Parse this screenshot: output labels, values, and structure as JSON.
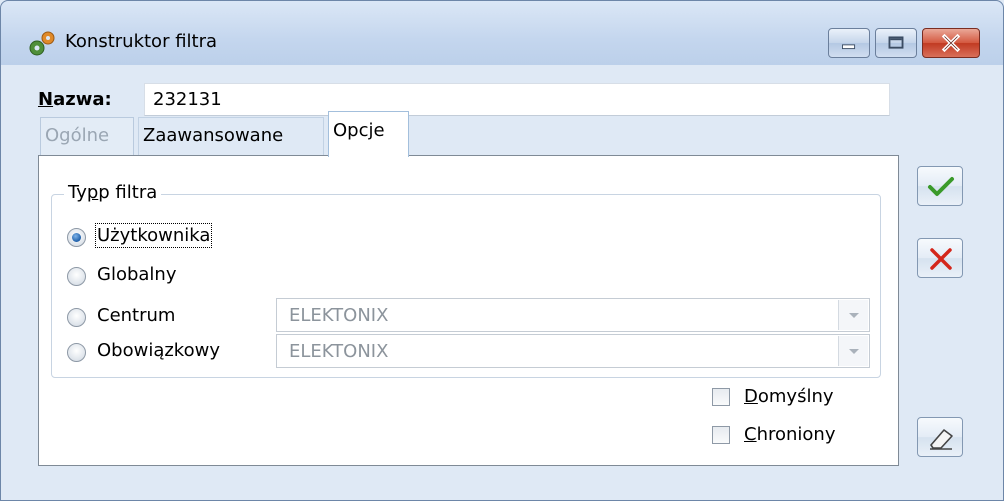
{
  "window": {
    "title": "Konstruktor filtra"
  },
  "form": {
    "name_label_first": "N",
    "name_label_rest": "azwa:",
    "name_value": "232131"
  },
  "tabs": [
    {
      "label": "Ogólne",
      "state": "disabled"
    },
    {
      "label": "Zaawansowane",
      "state": "normal"
    },
    {
      "label": "Opcje",
      "state": "active"
    }
  ],
  "filter_type": {
    "group_title_a": "Ty",
    "group_title_b": "p filtra",
    "options": [
      {
        "label": "Użytkownika",
        "checked": true
      },
      {
        "label": "Globalny",
        "checked": false
      },
      {
        "label": "Centrum",
        "checked": false,
        "combo_value": "ELEKTONIX"
      },
      {
        "label": "Obowiązkowy",
        "checked": false,
        "combo_value": "ELEKTONIX"
      }
    ]
  },
  "checkboxes": {
    "default_first": "D",
    "default_rest": "omyślny",
    "protected_first": "C",
    "protected_rest": "hroniony"
  },
  "colors": {
    "ok_check": "#3a9a2a",
    "cancel_x": "#d4261b"
  }
}
